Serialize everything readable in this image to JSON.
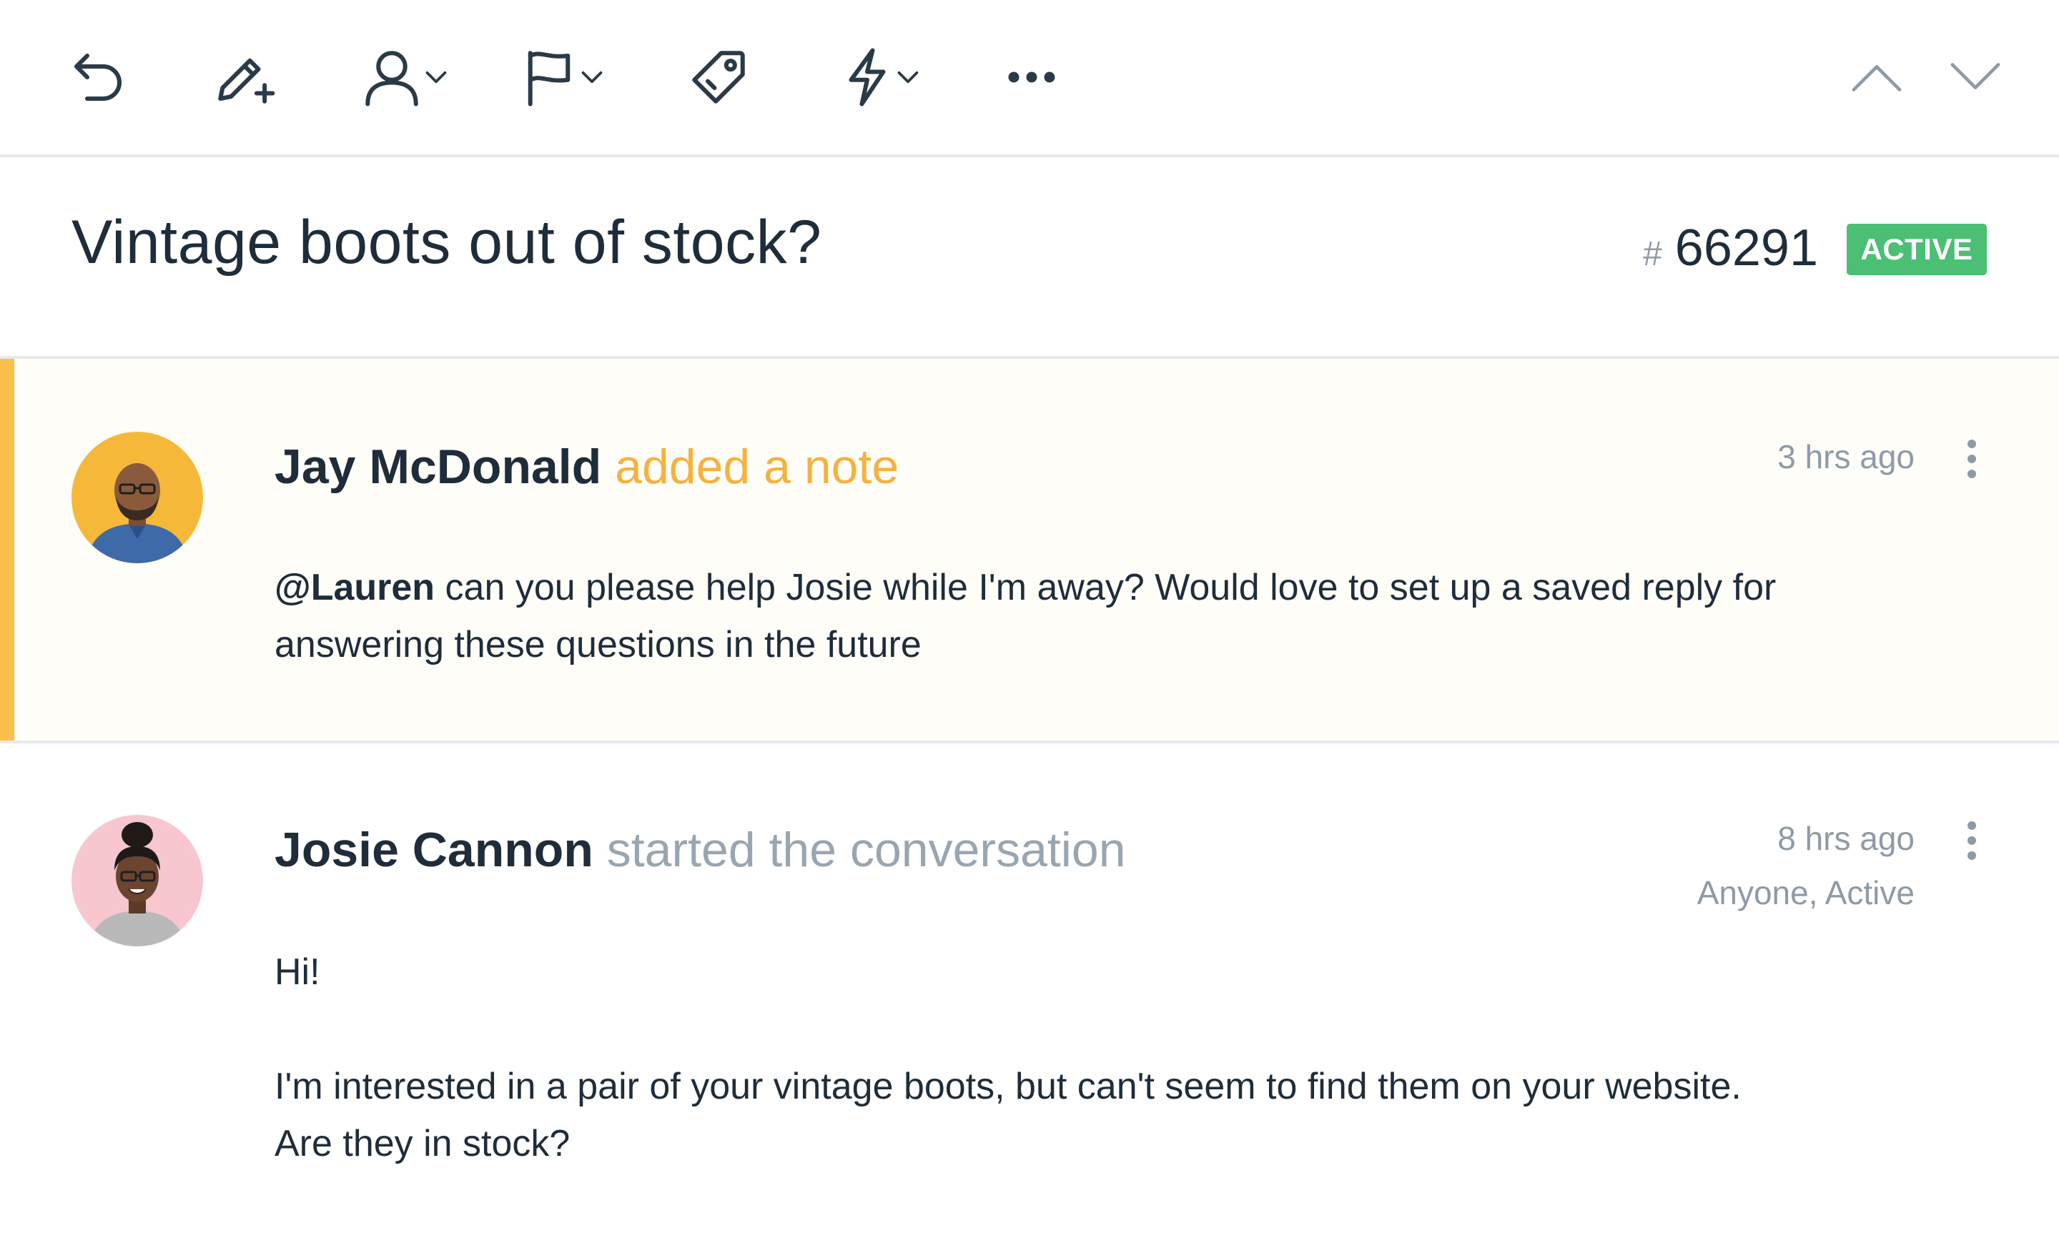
{
  "toolbar": {
    "buttons": [
      {
        "name": "undo",
        "icon": "undo-arrow-icon"
      },
      {
        "name": "add-note",
        "icon": "pencil-plus-icon"
      },
      {
        "name": "assign",
        "icon": "user-icon"
      },
      {
        "name": "status",
        "icon": "flag-icon"
      },
      {
        "name": "tag",
        "icon": "tag-icon"
      },
      {
        "name": "workflow",
        "icon": "lightning-icon"
      },
      {
        "name": "more",
        "icon": "ellipsis-icon"
      }
    ],
    "nav": [
      {
        "name": "previous",
        "icon": "chevron-up-icon"
      },
      {
        "name": "next",
        "icon": "chevron-down-icon"
      }
    ]
  },
  "conversation": {
    "subject": "Vintage boots out of stock?",
    "id_prefix": "#",
    "id": "66291",
    "status": "ACTIVE",
    "status_color": "#4bbf73"
  },
  "threads": [
    {
      "type": "note",
      "author": "Jay McDonald",
      "action": "added a note",
      "time": "3 hrs ago",
      "mention": "@Lauren",
      "text": "can you please help Josie while I'm away? Would love to set up a saved reply for answering these questions in the future",
      "accent_color": "#f9c04d"
    },
    {
      "type": "customer",
      "author": "Josie Cannon",
      "action": "started the conversation",
      "time": "8 hrs ago",
      "meta": "Anyone, Active",
      "greeting": "Hi!",
      "text_line1": "I'm interested in a pair of your vintage boots, but can't seem to find them on your website.",
      "text_line2": "Are they in stock?"
    }
  ]
}
